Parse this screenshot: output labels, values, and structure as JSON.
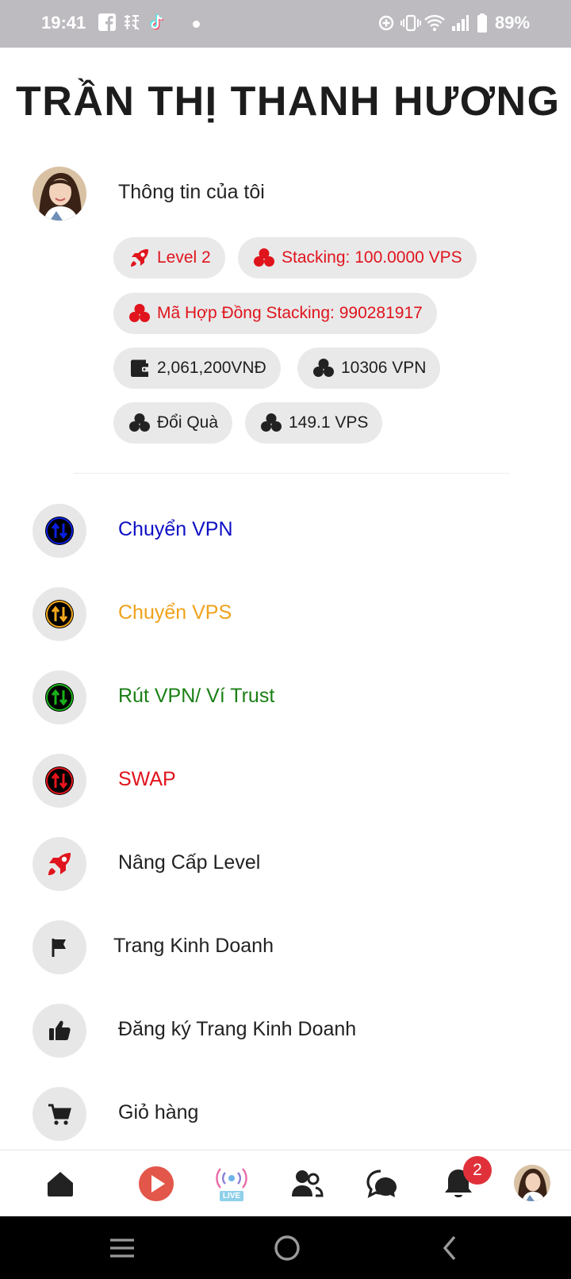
{
  "status_bar": {
    "time": "19:41",
    "battery": "89%",
    "icons": [
      "facebook-icon",
      "chinese-app-icon",
      "tiktok-icon",
      "dot-icon",
      "data-saver-icon",
      "vibrate-icon",
      "wifi-icon",
      "signal-icon",
      "battery-icon"
    ]
  },
  "header": {
    "name": "TRẦN THỊ THANH HƯƠNG"
  },
  "profile": {
    "label": "Thông tin của tôi"
  },
  "chips": {
    "level": "Level 2",
    "stacking": "Stacking: 100.0000 VPS",
    "contract": "Mã Hợp Đồng Stacking: 990281917",
    "wallet": "2,061,200VNĐ",
    "vpn": "10306 VPN",
    "gift": "Đổi Quà",
    "vps": "149.1 VPS"
  },
  "menu": {
    "items": [
      {
        "label": "Chuyển VPN",
        "color": "#0d0fc4",
        "icon": "transfer-icon",
        "icon_color": "#0b1fe0"
      },
      {
        "label": "Chuyển VPS",
        "color": "#f0a21a",
        "icon": "transfer-icon",
        "icon_color": "#f4a81c"
      },
      {
        "label": "Rút VPN/ Ví Trust",
        "color": "#1a7f14",
        "icon": "transfer-icon",
        "icon_color": "#19b21a"
      },
      {
        "label": "SWAP",
        "color": "#e0141c",
        "icon": "transfer-icon",
        "icon_color": "#e8141c"
      },
      {
        "label": "Nâng Cấp Level",
        "color": "#222222",
        "icon": "rocket-icon"
      },
      {
        "label": "Trang Kinh Doanh",
        "color": "#222222",
        "icon": "flag-icon"
      },
      {
        "label": "Đăng ký Trang Kinh Doanh",
        "color": "#222222",
        "icon": "thumbs-up-icon"
      },
      {
        "label": "Giỏ hàng",
        "color": "#222222",
        "icon": "cart-icon"
      }
    ]
  },
  "bottom_nav": {
    "items": [
      "home-icon",
      "video-play-icon",
      "live-icon",
      "friends-icon",
      "chat-icon",
      "notifications-icon",
      "profile-avatar"
    ],
    "live_label": "LIVE",
    "notification_count": "2"
  },
  "colors": {
    "accent_red": "#e0141c",
    "chip_bg": "#e9e9ea",
    "status_bar": "#bdbbc0"
  }
}
